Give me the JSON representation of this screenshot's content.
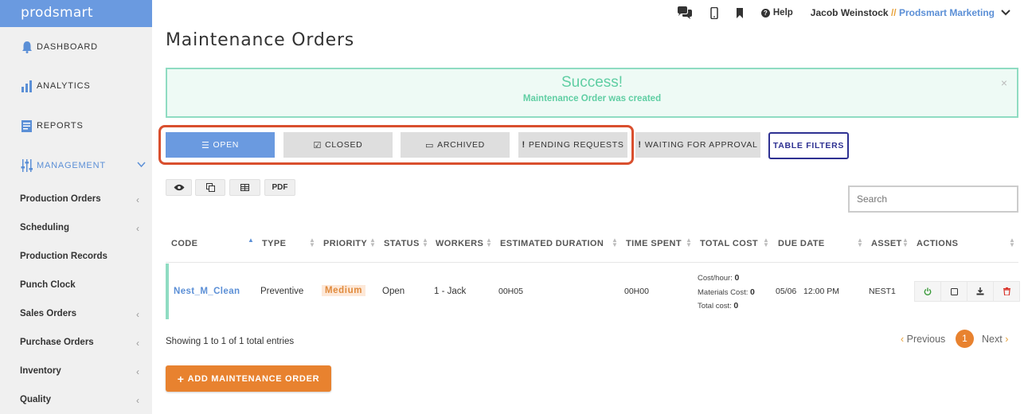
{
  "app": {
    "brand": "prodsmart"
  },
  "sidebar": {
    "main": [
      {
        "label": "DASHBOARD",
        "icon": "bell-icon"
      },
      {
        "label": "ANALYTICS",
        "icon": "bar-chart-icon"
      },
      {
        "label": "REPORTS",
        "icon": "document-icon"
      },
      {
        "label": "MANAGEMENT",
        "icon": "sliders-icon"
      }
    ],
    "sub": [
      {
        "label": "Production Orders",
        "arrow": "‹"
      },
      {
        "label": "Scheduling",
        "arrow": "‹"
      },
      {
        "label": "Production Records",
        "arrow": ""
      },
      {
        "label": "Punch Clock",
        "arrow": ""
      },
      {
        "label": "Sales Orders",
        "arrow": "‹"
      },
      {
        "label": "Purchase Orders",
        "arrow": "‹"
      },
      {
        "label": "Inventory",
        "arrow": "‹"
      },
      {
        "label": "Quality",
        "arrow": "‹"
      }
    ]
  },
  "topbar": {
    "help": "Help",
    "user_name": "Jacob Weinstock",
    "separator": "//",
    "org": "Prodsmart Marketing"
  },
  "page": {
    "title": "Maintenance Orders"
  },
  "alert": {
    "title": "Success!",
    "message": "Maintenance Order was created",
    "close": "×"
  },
  "tabs": [
    {
      "label": "OPEN",
      "glyph": "☰"
    },
    {
      "label": "CLOSED",
      "glyph": "☑"
    },
    {
      "label": "ARCHIVED",
      "glyph": "▭"
    },
    {
      "label": "PENDING REQUESTS",
      "glyph": "!"
    },
    {
      "label": "WAITING FOR APPROVAL",
      "glyph": "!"
    }
  ],
  "table_filters": "TABLE FILTERS",
  "toolbar": {
    "pdf": "PDF"
  },
  "search": {
    "placeholder": "Search"
  },
  "table": {
    "headers": [
      "CODE",
      "TYPE",
      "PRIORITY",
      "STATUS",
      "WORKERS",
      "ESTIMATED DURATION",
      "TIME SPENT",
      "TOTAL COST",
      "DUE DATE",
      "ASSET",
      "ACTIONS"
    ],
    "row": {
      "code": "Nest_M_Clean",
      "type": "Preventive",
      "priority": "Medium",
      "status": "Open",
      "workers": "1 - Jack",
      "estimated_duration": "00H05",
      "time_spent": "00H00",
      "cost_hour_label": "Cost/hour:",
      "cost_hour": "0",
      "materials_label": "Materials Cost:",
      "materials": "0",
      "total_label": "Total cost:",
      "total": "0",
      "due_date": "05/06",
      "due_time": "12:00 PM",
      "asset": "NEST1"
    }
  },
  "footer": {
    "showing": "Showing 1 to 1 of 1 total entries",
    "previous": "Previous",
    "page": "1",
    "next": "Next",
    "add_button": "ADD MAINTENANCE ORDER"
  },
  "colors": {
    "brand": "#6a9ae0",
    "accent_orange": "#e8822f",
    "success": "#5fcea3",
    "highlight_outline": "#d94f2e",
    "filters_border": "#2e3192"
  }
}
